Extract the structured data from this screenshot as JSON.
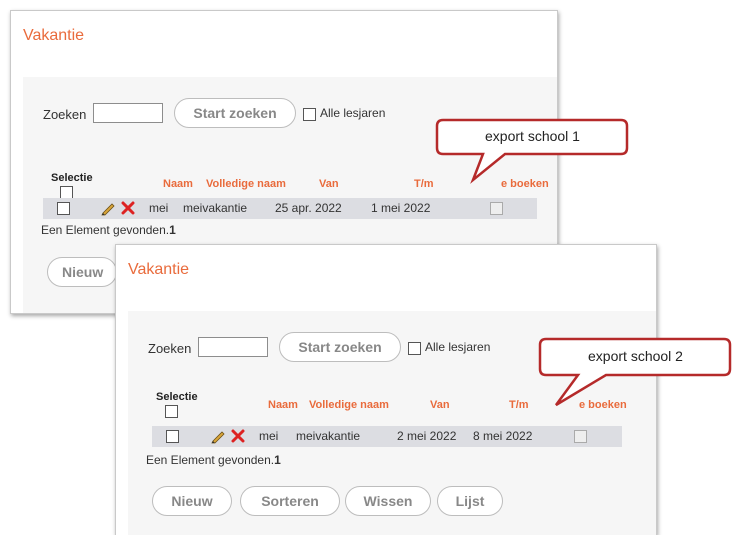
{
  "panel1": {
    "title": "Vakantie",
    "search_label": "Zoeken",
    "search_value": "",
    "search_button": "Start zoeken",
    "all_years_label": "Alle lesjaren",
    "selection_header": "Selectie",
    "columns": [
      "Naam",
      "Volledige naam",
      "Van",
      "T/m",
      "e boeken"
    ],
    "row": {
      "naam": "mei",
      "volledige_naam": "meivakantie",
      "van": "25 apr. 2022",
      "tm": "1 mei 2022"
    },
    "found_text": "Een Element gevonden.",
    "found_count": "1",
    "buttons": [
      "Nieuw"
    ]
  },
  "panel2": {
    "title": "Vakantie",
    "search_label": "Zoeken",
    "search_value": "",
    "search_button": "Start zoeken",
    "all_years_label": "Alle lesjaren",
    "selection_header": "Selectie",
    "columns": [
      "Naam",
      "Volledige naam",
      "Van",
      "T/m",
      "e boeken"
    ],
    "row": {
      "naam": "mei",
      "volledige_naam": "meivakantie",
      "van": "2 mei 2022",
      "tm": "8 mei 2022"
    },
    "found_text": "Een Element gevonden.",
    "found_count": "1",
    "buttons": [
      "Nieuw",
      "Sorteren",
      "Wissen",
      "Lijst"
    ]
  },
  "callouts": [
    "export school 1",
    "export school 2"
  ],
  "colors": {
    "accent": "#e96b3c",
    "callout_border": "#b52a2a",
    "row_bg": "#dcdde2"
  }
}
